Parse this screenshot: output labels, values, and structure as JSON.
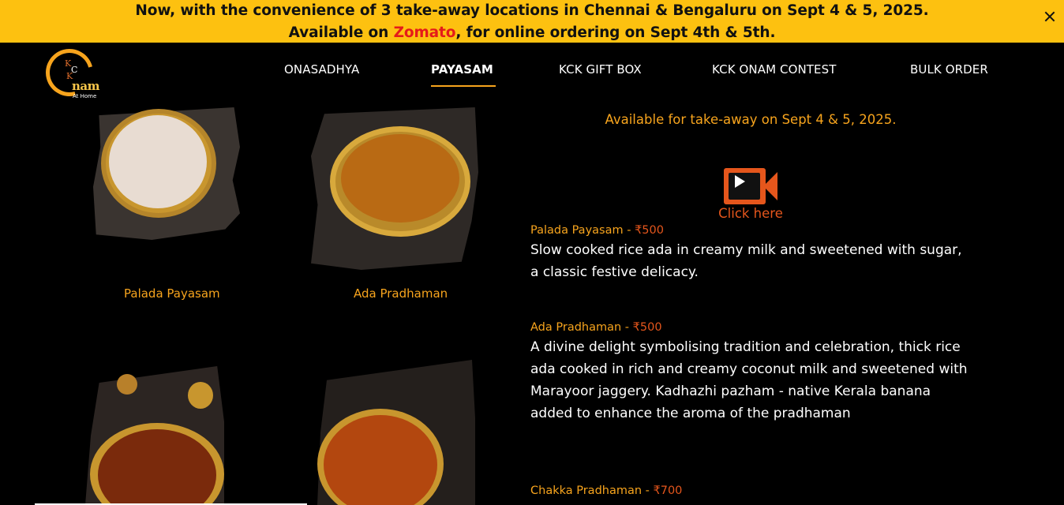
{
  "announcement": {
    "line1": "Now, with the convenience of 3 take-away locations in Chennai & Bengaluru on Sept 4 & 5, 2025.",
    "line2_prefix": "Available on ",
    "line2_brand": "Zomato",
    "line2_suffix": ", for online ordering on Sept 4th & 5th.",
    "brand_color": "#e51a1a",
    "bar_color": "#fdc110"
  },
  "logo": {
    "letters_k1": "K",
    "letters_c": "C",
    "letters_k2": "K",
    "wordmark": "nam",
    "tagline": "At Home"
  },
  "nav": {
    "items": [
      {
        "label": "ONASADHYA",
        "active": false
      },
      {
        "label": "PAYASAM",
        "active": true
      },
      {
        "label": "KCK GIFT BOX",
        "active": false
      },
      {
        "label": "KCK ONAM CONTEST",
        "active": false
      },
      {
        "label": "BULK ORDER",
        "active": false
      }
    ],
    "accent": "#f7a41d"
  },
  "products": [
    {
      "caption": "Palada Payasam"
    },
    {
      "caption": "Ada Pradhaman"
    }
  ],
  "info": {
    "availability": "Available for take-away on Sept 4 & 5, 2025.",
    "video_icon": "video-camera-icon",
    "click_here": "Click here",
    "items": [
      {
        "name": "Palada Payasam - ",
        "price": "₹500",
        "description": "Slow cooked rice ada in creamy milk and sweetened with sugar, a classic festive delicacy."
      },
      {
        "name": "Ada Pradhaman - ",
        "price": "₹500",
        "description": "A divine delight symbolising tradition and celebration, thick rice ada cooked in rich and creamy coconut milk and sweetened with Marayoor jaggery. Kadhazhi pazham - native Kerala banana added to enhance the aroma of the pradhaman"
      },
      {
        "name": "Chakka Pradhaman - ",
        "price": "₹700"
      }
    ]
  }
}
